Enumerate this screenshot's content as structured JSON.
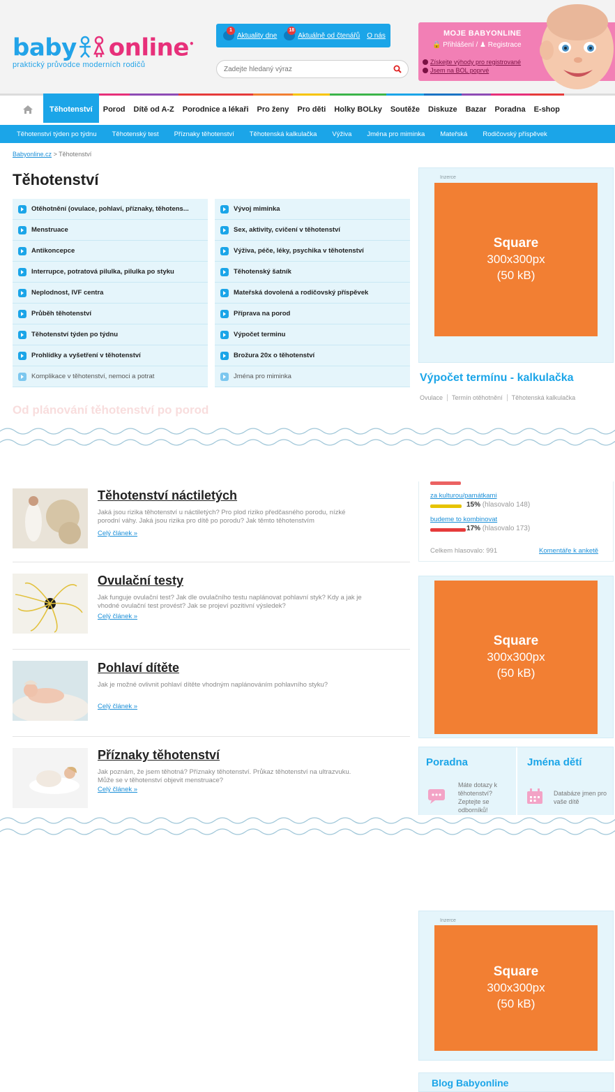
{
  "header": {
    "logo": {
      "part1": "baby",
      "part2": "online",
      "tagline": "praktický průvodce moderních rodičů"
    },
    "topbar": {
      "aktuality_count": "1",
      "aktuality_label": "Aktuality dne",
      "ctenari_count": "18",
      "ctenari_label": "Aktuálně od čtenářů",
      "onas_label": "O nás"
    },
    "search": {
      "placeholder": "Zadejte hledaný výraz"
    },
    "moje": {
      "title": "MOJE BABYONLINE",
      "login": "Přihlášení",
      "separator": "/",
      "register": "Registrace",
      "perk1": "Získejte výhody pro registrované",
      "perk2": "Jsem na BOL poprvé"
    }
  },
  "mainnav": {
    "items": [
      {
        "label": "Těhotenství",
        "color": "#1ba5e8"
      },
      {
        "label": "Porod",
        "color": "#e7307a"
      },
      {
        "label": "Dítě od A-Z",
        "color": "#8e4bb5"
      },
      {
        "label": "Porodnice a lékaři",
        "color": "#e63b3b"
      },
      {
        "label": "Pro ženy",
        "color": "#f27f33"
      },
      {
        "label": "Pro děti",
        "color": "#f7c400"
      },
      {
        "label": "Holky BOLky",
        "color": "#3cb54a"
      },
      {
        "label": "Soutěže",
        "color": "#1ba5e8"
      },
      {
        "label": "Diskuze",
        "color": "#1a73c4"
      },
      {
        "label": "Bazar",
        "color": "#8e4bb5"
      },
      {
        "label": "Poradna",
        "color": "#e7307a"
      },
      {
        "label": "E-shop",
        "color": "#e63b3b"
      }
    ]
  },
  "subnav": {
    "items": [
      "Těhotenství týden po týdnu",
      "Těhotenský test",
      "Příznaky těhotenství",
      "Těhotenská kalkulačka",
      "Výživa",
      "Jména pro miminka",
      "Mateřská",
      "Rodičovský příspěvek"
    ]
  },
  "breadcrumb": {
    "home": "Babyonline.cz",
    "sep": ">",
    "current": "Těhotenství"
  },
  "page": {
    "title": "Těhotenství"
  },
  "categories": {
    "left": [
      "Otěhotnění (ovulace, pohlaví, příznaky, těhotens...",
      "Menstruace",
      "Antikoncepce",
      "Interrupce, potratová pilulka, pilulka po styku",
      "Neplodnost, IVF centra",
      "Průběh těhotenství",
      "Těhotenství týden po týdnu",
      "Prohlídky a vyšetření v těhotenství",
      "Komplikace v těhotenství, nemoci a potrat"
    ],
    "right": [
      "Vývoj miminka",
      "Sex, aktivity, cvičení v těhotenství",
      "Výživa, péče, léky, psychika v těhotenství",
      "Těhotenský šatník",
      "Mateřská dovolená a rodičovský příspěvek",
      "Příprava na porod",
      "Výpočet terminu",
      "Brožura 20x o těhotenství",
      "Jména pro miminka"
    ]
  },
  "ghost_heading": "Od plánování těhotenství po porod",
  "ads": {
    "label": "Inzerce",
    "title": "Square",
    "size": "300x300px",
    "weight": "(50 kB)"
  },
  "calculator": {
    "title": "Výpočet termínu - kalkulačka",
    "tabs": [
      "Ovulace",
      "Termín otěhotnění",
      "Těhotenská kalkulačka"
    ]
  },
  "articles": [
    {
      "title": "Těhotenství náctiletých",
      "desc": "Jaká jsou rizika těhotenství u náctiletých? Pro plod riziko předčasného porodu, nízké porodní váhy. Jaká jsou rizika pro dítě po porodu? Jak těmto těhotenstvím",
      "more": "Celý článek »"
    },
    {
      "title": "Ovulační testy",
      "desc": "Jak funguje ovulační test? Jak dle ovulačního testu naplánovat pohlavní styk? Kdy a jak je vhodné ovulační test provést? Jak se projeví pozitivní výsledek?",
      "more": "Celý článek »"
    },
    {
      "title": "Pohlaví dítěte",
      "desc": "Jak je možné ovlivnit pohlaví dítěte vhodným naplánováním pohlavního styku?",
      "more": "Celý článek »"
    },
    {
      "title": "Příznaky těhotenství",
      "desc": "Jak poznám, že jsem těhotná? Příznaky těhotenství. Průkaz těhotenství na ultrazvuku. Může se v těhotenství objevit menstruace?",
      "more": "Celý článek »"
    }
  ],
  "poll": {
    "options": [
      {
        "label": "za kulturou/památkami",
        "pct": "15%",
        "votes": "(hlasovalo 148)",
        "color": "#e6c300",
        "share": 0.15
      },
      {
        "label": "budeme to kombinovat",
        "pct": "17%",
        "votes": "(hlasovalo 173)",
        "color": "#e63b3b",
        "share": 0.17
      }
    ],
    "total": "Celkem hlasovalo: 991",
    "comments": "Komentáře k anketě"
  },
  "widget": {
    "left": {
      "title": "Poradna",
      "text": "Máte dotazy k těhotenství? Zeptejte se odborníků!"
    },
    "right": {
      "title": "Jména dětí",
      "text": "Databáze jmen pro vaše dítě"
    }
  },
  "blog": {
    "title": "Blog Babyonline"
  }
}
